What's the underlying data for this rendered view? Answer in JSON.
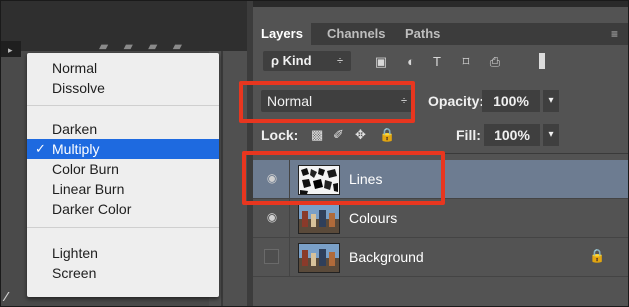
{
  "blend_menu": {
    "items": [
      {
        "label": "Normal"
      },
      {
        "label": "Dissolve"
      },
      {
        "label": "Darken"
      },
      {
        "label": "Multiply",
        "check": "✓"
      },
      {
        "label": "Color Burn"
      },
      {
        "label": "Linear Burn"
      },
      {
        "label": "Darker Color"
      },
      {
        "label": "Lighten"
      },
      {
        "label": "Screen"
      }
    ]
  },
  "panel": {
    "tabs": [
      "Layers",
      "Channels",
      "Paths"
    ],
    "menu_icon": "≡",
    "kind_filter": {
      "label": "ρ Kind",
      "arrow": "÷"
    },
    "filter_icons": {
      "pixel": "▣",
      "adjustment": "◐",
      "type": "T",
      "shape": "⌑",
      "smart": "⎙"
    },
    "blend_mode": {
      "value": "Normal",
      "arrow": "÷"
    },
    "opacity": {
      "label": "Opacity:",
      "value": "100%",
      "arrow": "▾"
    },
    "lock": {
      "label": "Lock:",
      "icons": {
        "pixels": "▩",
        "brush": "✐",
        "move": "✥",
        "all": "🔒"
      }
    },
    "fill": {
      "label": "Fill:",
      "value": "100%",
      "arrow": "▾"
    },
    "layers": [
      {
        "name": "Lines",
        "visible": true,
        "selected": true
      },
      {
        "name": "Colours",
        "visible": true
      },
      {
        "name": "Background",
        "visible": false,
        "locked": true,
        "lock_icon": "🔒"
      }
    ],
    "eye_glyph": "◉"
  },
  "left_area": {
    "top_icons": "▰ ▰ ▰ ▰",
    "bottom_glyph": "∕",
    "caret": "▸"
  },
  "colors": {
    "highlight": "#e8361f",
    "menu_selected": "#1e6ae0",
    "layer_selected": "#6d7c91",
    "panel_bg": "#535353"
  }
}
